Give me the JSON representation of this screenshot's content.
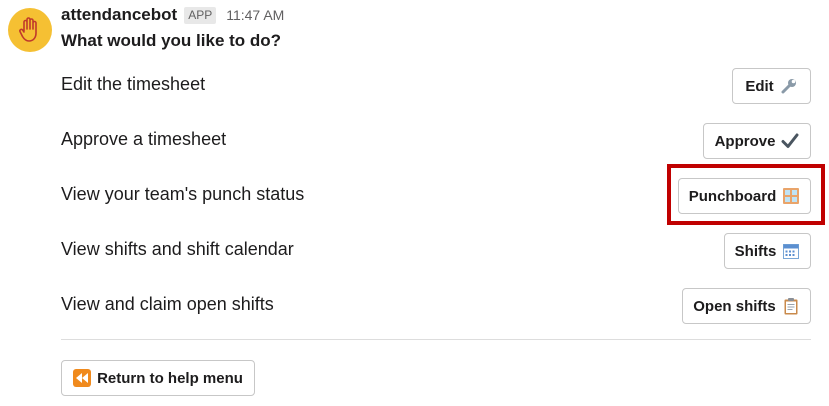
{
  "message": {
    "bot_name": "attendancebot",
    "badge": "APP",
    "timestamp": "11:47 AM",
    "prompt": "What would you like to do?"
  },
  "options": [
    {
      "label": "Edit the timesheet",
      "button": "Edit",
      "icon": "wrench-icon"
    },
    {
      "label": "Approve a timesheet",
      "button": "Approve",
      "icon": "check-mark-icon"
    },
    {
      "label": "View your team's punch status",
      "button": "Punchboard",
      "icon": "window-icon"
    },
    {
      "label": "View shifts and shift calendar",
      "button": "Shifts",
      "icon": "calendar-icon"
    },
    {
      "label": "View and claim open shifts",
      "button": "Open shifts",
      "icon": "clipboard-icon"
    }
  ],
  "footer": {
    "return_label": "Return to help menu",
    "return_icon": "rewind-icon"
  },
  "colors": {
    "avatar": "#f5c033",
    "highlight": "#c00000",
    "rewind": "#f08a1d"
  }
}
